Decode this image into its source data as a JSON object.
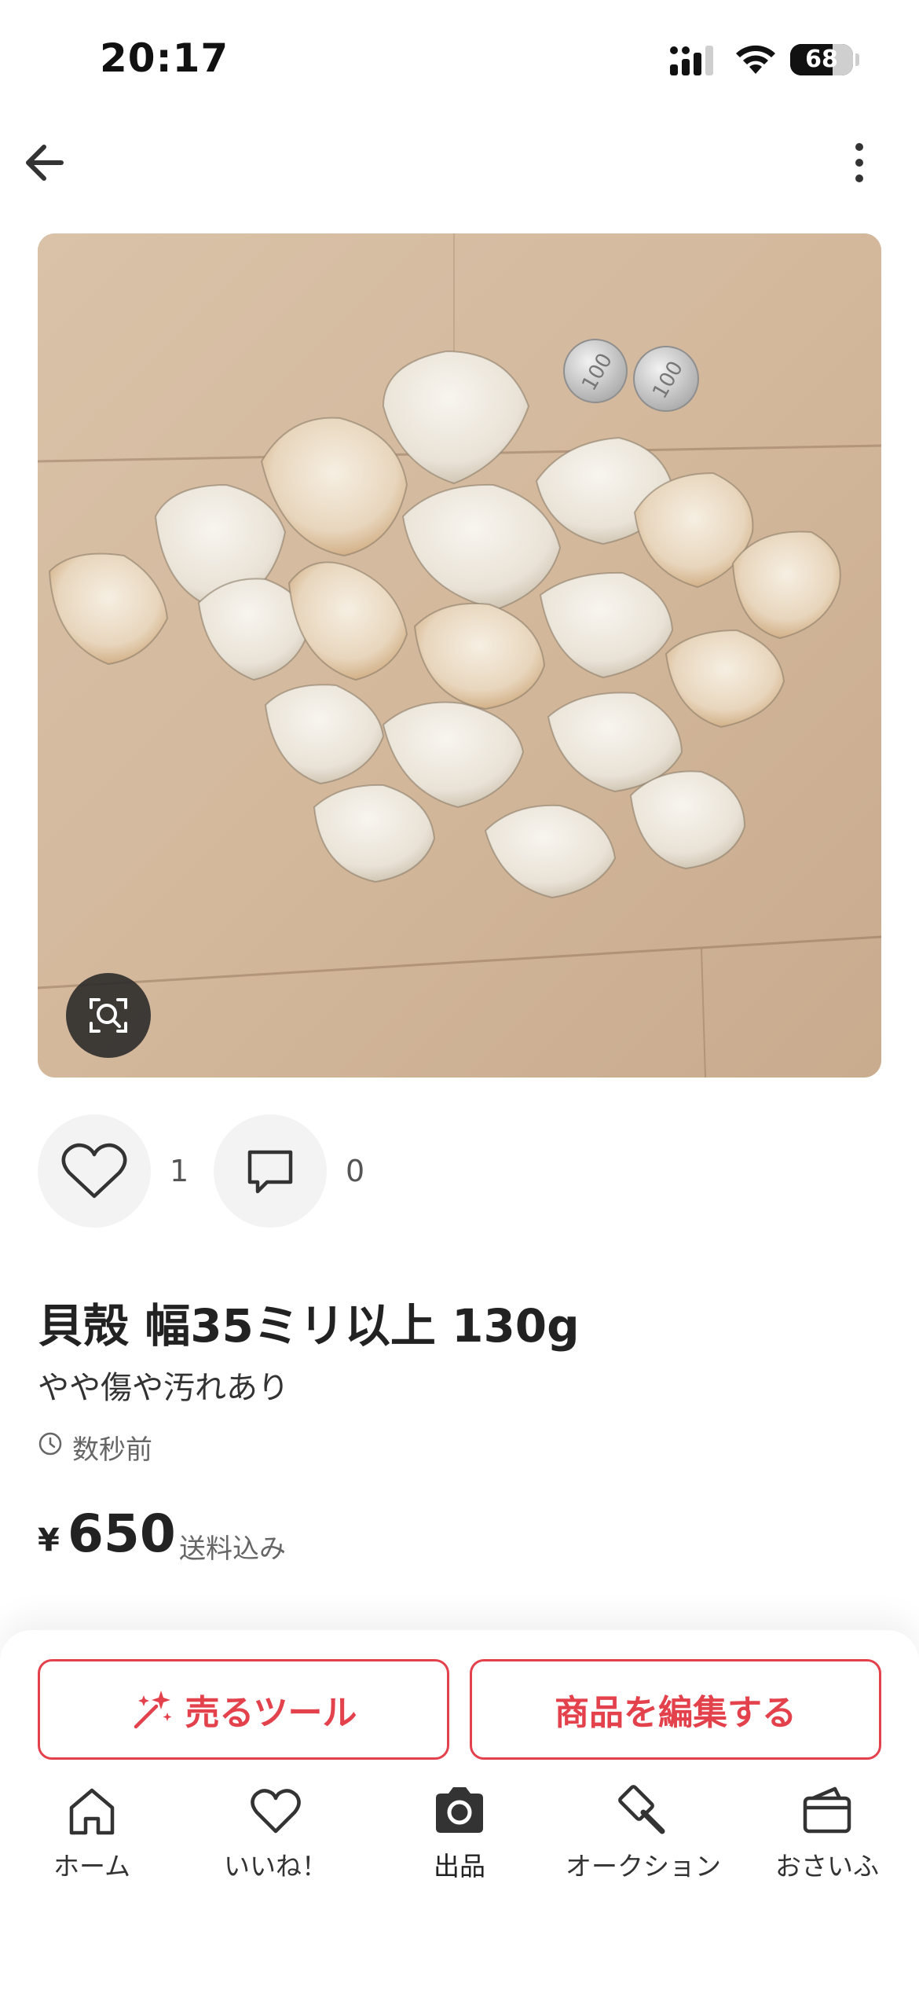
{
  "status_bar": {
    "time": "20:17",
    "battery": "68",
    "battery_level": 0.68
  },
  "header": {
    "back_icon": "arrow-left-icon",
    "more_icon": "vertical-dots-icon"
  },
  "photo": {
    "description_icon": "image-search-icon"
  },
  "actions": {
    "like_count": "1",
    "comment_count": "0"
  },
  "item": {
    "title": "貝殻 幅35ミリ以上 130g",
    "condition": "やや傷や汚れあり",
    "posted": "数秒前",
    "currency": "¥",
    "price": "650",
    "shipping": "送料込み"
  },
  "buttons": {
    "sell_tool": "売るツール",
    "edit_item": "商品を編集する"
  },
  "bottom_nav": [
    {
      "label": "ホーム",
      "icon": "home-icon"
    },
    {
      "label": "いいね！",
      "icon": "heart-icon"
    },
    {
      "label": "出品",
      "icon": "camera-icon"
    },
    {
      "label": "オークション",
      "icon": "gavel-icon"
    },
    {
      "label": "おさいふ",
      "icon": "wallet-icon"
    }
  ],
  "colors": {
    "accent": "#e3424d",
    "text": "#333333"
  }
}
